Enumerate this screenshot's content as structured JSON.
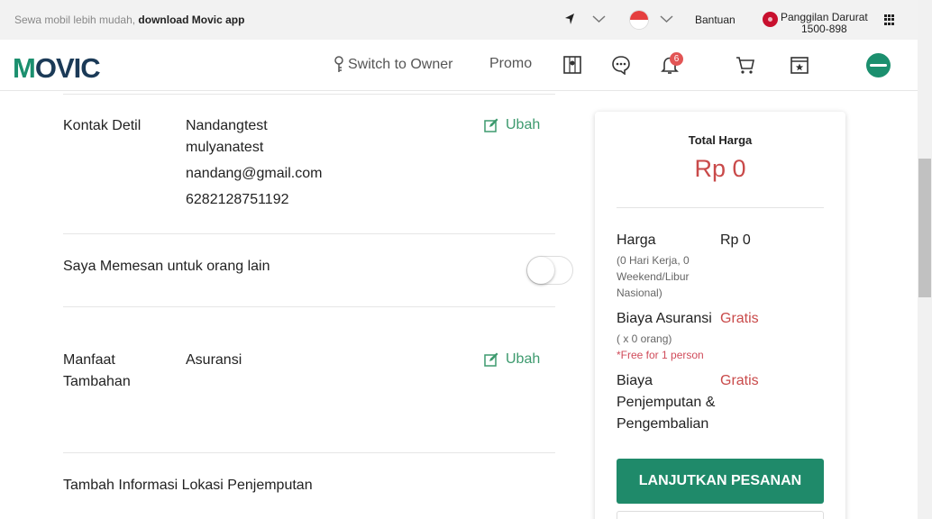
{
  "topbar": {
    "promo_text": "Sewa mobil lebih mudah, ",
    "promo_link": "download Movic app",
    "help": "Bantuan",
    "emergency_line1": "Panggilan Darurat",
    "emergency_line2": "1500-898"
  },
  "header": {
    "logo": "MOVIC",
    "switch_owner": "Switch to Owner",
    "promo": "Promo",
    "notification_count": "6"
  },
  "contact": {
    "label": "Kontak Detil",
    "name_line1": "Nandangtest",
    "name_line2": "mulyanatest",
    "email": "nandang@gmail.com",
    "phone": "6282128751192",
    "edit": "Ubah"
  },
  "order_for_other": {
    "label": "Saya Memesan untuk orang lain",
    "enabled": false
  },
  "benefits": {
    "label_line1": "Manfaat",
    "label_line2": "Tambahan",
    "value": "Asuransi",
    "edit": "Ubah"
  },
  "pickup": {
    "label": "Tambah Informasi Lokasi Penjemputan"
  },
  "summary": {
    "total_label": "Total Harga",
    "total_value": "Rp 0",
    "price_label": "Harga",
    "price_value": "Rp 0",
    "price_detail_1": "(0 Hari Kerja, 0",
    "price_detail_2": "Weekend/Libur",
    "price_detail_3": "Nasional)",
    "insurance_label": "Biaya Asuransi",
    "insurance_value": "Gratis",
    "insurance_detail": "( x 0 orang)",
    "insurance_free": "*Free for 1 person",
    "delivery_label_1": "Biaya",
    "delivery_label_2": "Penjemputan &",
    "delivery_label_3": "Pengembalian",
    "delivery_value": "Gratis",
    "continue_button": "LANJUTKAN PESANAN"
  },
  "colors": {
    "brand_green": "#1f8a6a",
    "accent_red": "#c94a4a",
    "link_green": "#3d9a6e"
  }
}
